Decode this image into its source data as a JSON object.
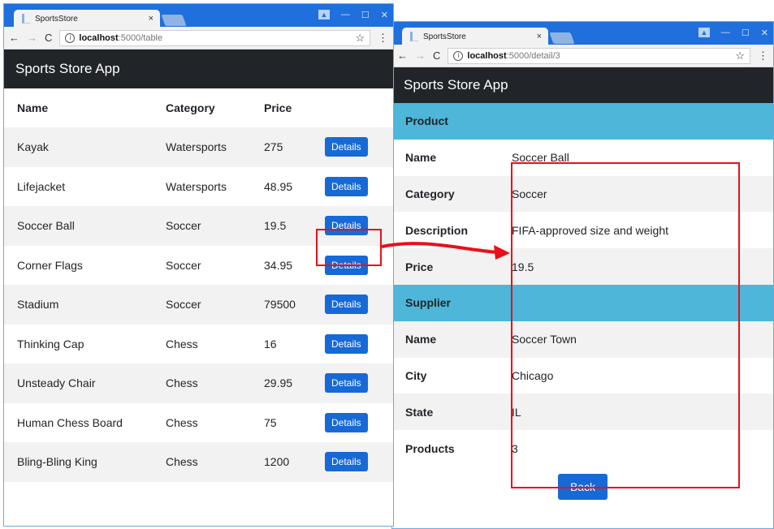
{
  "left_window": {
    "tab_title": "SportsStore",
    "url_host": "localhost",
    "url_path": ":5000/table",
    "app_title": "Sports Store App",
    "columns": [
      "Name",
      "Category",
      "Price"
    ],
    "rows": [
      {
        "name": "Kayak",
        "category": "Watersports",
        "price": "275",
        "action": "Details"
      },
      {
        "name": "Lifejacket",
        "category": "Watersports",
        "price": "48.95",
        "action": "Details"
      },
      {
        "name": "Soccer Ball",
        "category": "Soccer",
        "price": "19.5",
        "action": "Details"
      },
      {
        "name": "Corner Flags",
        "category": "Soccer",
        "price": "34.95",
        "action": "Details"
      },
      {
        "name": "Stadium",
        "category": "Soccer",
        "price": "79500",
        "action": "Details"
      },
      {
        "name": "Thinking Cap",
        "category": "Chess",
        "price": "16",
        "action": "Details"
      },
      {
        "name": "Unsteady Chair",
        "category": "Chess",
        "price": "29.95",
        "action": "Details"
      },
      {
        "name": "Human Chess Board",
        "category": "Chess",
        "price": "75",
        "action": "Details"
      },
      {
        "name": "Bling-Bling King",
        "category": "Chess",
        "price": "1200",
        "action": "Details"
      }
    ]
  },
  "right_window": {
    "tab_title": "SportsStore",
    "url_host": "localhost",
    "url_path": ":5000/detail/3",
    "app_title": "Sports Store App",
    "product_header": "Product",
    "product": [
      {
        "label": "Name",
        "value": "Soccer Ball"
      },
      {
        "label": "Category",
        "value": "Soccer"
      },
      {
        "label": "Description",
        "value": "FIFA-approved size and weight"
      },
      {
        "label": "Price",
        "value": "19.5"
      }
    ],
    "supplier_header": "Supplier",
    "supplier": [
      {
        "label": "Name",
        "value": "Soccer Town"
      },
      {
        "label": "City",
        "value": "Chicago"
      },
      {
        "label": "State",
        "value": "IL"
      },
      {
        "label": "Products",
        "value": "3"
      }
    ],
    "back_label": "Back"
  },
  "colors": {
    "titlebar": "#1f6fdc",
    "appbar": "#212529",
    "button": "#1769d6",
    "section_header": "#4db6d9",
    "highlight": "#e8101a"
  },
  "icons": {
    "back": "arrow-left-icon",
    "forward": "arrow-right-icon",
    "reload": "reload-icon",
    "info": "info-icon",
    "bookmark": "star-icon",
    "menu": "kebab-menu-icon",
    "user": "user-icon",
    "minimize": "minimize-icon",
    "maximize": "maximize-icon",
    "close": "close-icon"
  }
}
